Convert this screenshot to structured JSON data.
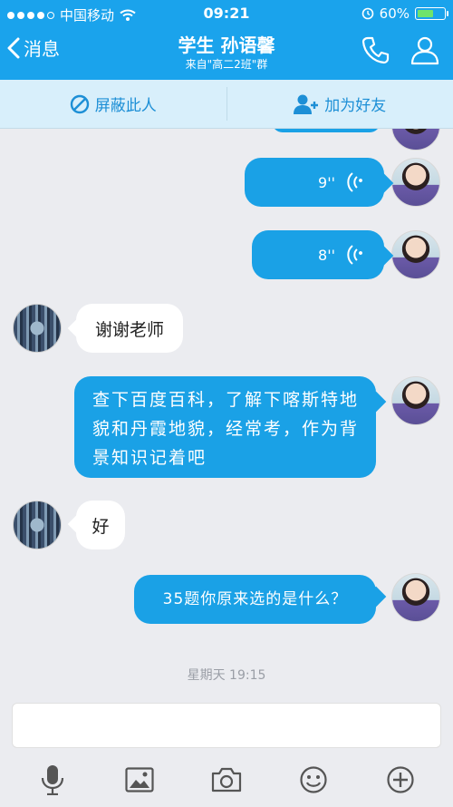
{
  "status_bar": {
    "carrier": "中国移动",
    "time": "09:21",
    "battery": "60%",
    "battery_level": 0.6
  },
  "nav": {
    "back_label": "消息",
    "title": "学生 孙语馨",
    "subtitle": "来自\"高二2班\"群"
  },
  "actions": {
    "block": "屏蔽此人",
    "add_friend": "加为好友"
  },
  "messages": [
    {
      "from": "teacher",
      "type": "voice",
      "duration": "9''"
    },
    {
      "from": "teacher",
      "type": "voice",
      "duration": "8''"
    },
    {
      "from": "student",
      "type": "text",
      "text": "谢谢老师"
    },
    {
      "from": "teacher",
      "type": "text",
      "line1": "查下百度百科，了解下喀斯特地",
      "line2": "貌和丹霞地貌，经常考，作为背",
      "line3": "景知识记着吧"
    },
    {
      "from": "student",
      "type": "text",
      "text": "好"
    },
    {
      "from": "teacher",
      "type": "text",
      "text": "35题你原来选的是什么？"
    }
  ],
  "timestamp": "星期天 19:15",
  "colors": {
    "brand": "#1aa3ec",
    "bubble_out": "#1aa1e6",
    "action_bar": "#d8effb",
    "background": "#ebecf0"
  },
  "toolbar_icons": [
    "microphone-icon",
    "image-icon",
    "camera-icon",
    "emoji-icon",
    "plus-icon"
  ]
}
